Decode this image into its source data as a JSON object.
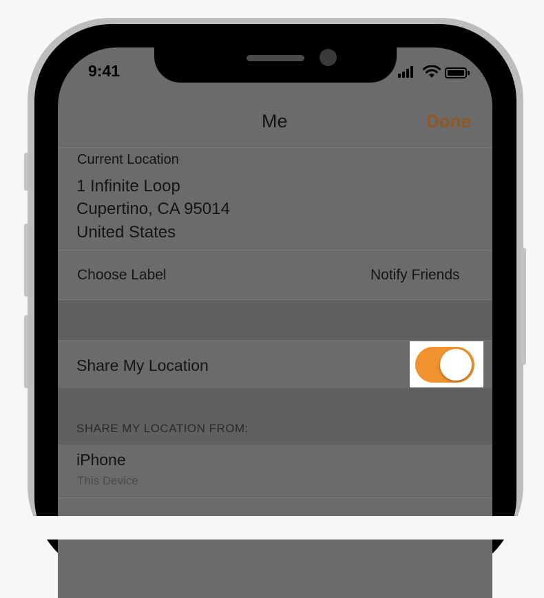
{
  "status_bar": {
    "time": "9:41",
    "icons": [
      "signal-icon",
      "wifi-icon",
      "battery-icon"
    ]
  },
  "nav": {
    "title": "Me",
    "done_label": "Done"
  },
  "current_location": {
    "label": "Current Location",
    "line1": "1 Infinite Loop",
    "line2": "Cupertino, CA  95014",
    "line3": "United States"
  },
  "actions": {
    "choose_label": "Choose Label",
    "notify_friends": "Notify Friends"
  },
  "share": {
    "label": "Share My Location",
    "enabled": true
  },
  "share_from": {
    "header": "SHARE MY LOCATION FROM:",
    "device_name": "iPhone",
    "device_subtitle": "This Device"
  },
  "colors": {
    "accent": "#f2922e",
    "accent_dimmed": "#8a5326",
    "overlay": "#6b6b6b"
  }
}
